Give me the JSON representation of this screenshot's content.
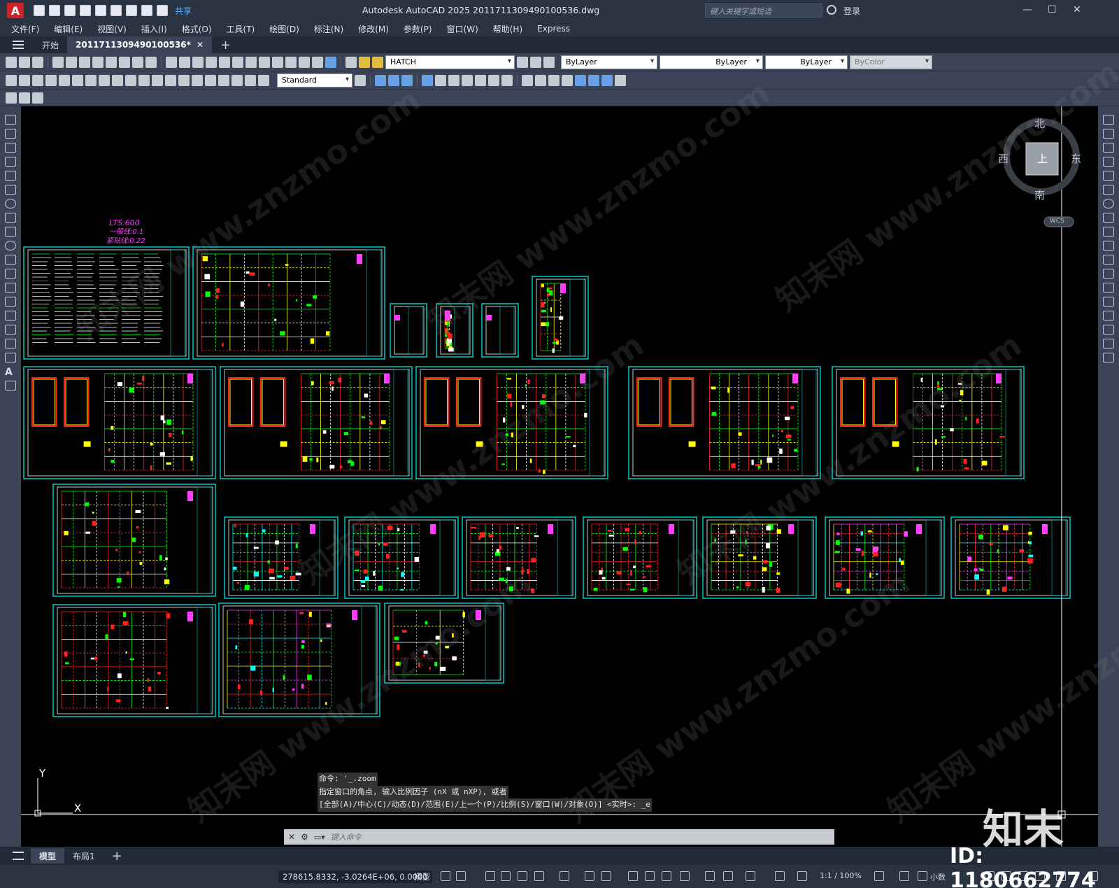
{
  "titlebar": {
    "title": "Autodesk AutoCAD 2025    20117113094901005​36.dwg",
    "search_placeholder": "键入关键字或短语",
    "login": "登录",
    "share": "共享"
  },
  "menu": [
    "文件(F)",
    "编辑(E)",
    "视图(V)",
    "插入(I)",
    "格式(O)",
    "工具(T)",
    "绘图(D)",
    "标注(N)",
    "修改(M)",
    "参数(P)",
    "窗口(W)",
    "帮助(H)",
    "Express"
  ],
  "tabs": {
    "start": "开始",
    "active": "20117113094901005​36*"
  },
  "toolbar": {
    "layer": "HATCH",
    "color": "ByLayer",
    "linetype": "ByLayer",
    "lineweight": "ByLayer",
    "plotstyle": "ByColor",
    "textstyle": "Standard"
  },
  "viewcube": {
    "north": "北",
    "south": "南",
    "east": "东",
    "west": "西",
    "top": "上",
    "wcs": "WCS"
  },
  "drawing_notes": {
    "lts": "LTS:600",
    "line1": "一般线:0.1",
    "line2": "紧贴线:0.22"
  },
  "ucs": {
    "x": "X",
    "y": "Y"
  },
  "command": {
    "history": [
      "命令: '_.zoom",
      "指定窗口的角点, 输入比例因子 (nX 或 nXP), 或者",
      "[全部(A)/中心(C)/动态(D)/范围(E)/上一个(P)/比例(S)/窗口(W)/对象(O)] <实时>: _e"
    ],
    "placeholder": "键入命令"
  },
  "layout_tabs": [
    "模型",
    "布局1"
  ],
  "status": {
    "coords": "278615.8332, -3.0264E+06, 0.0000",
    "model": "模型",
    "scale": "1:1 / 100%",
    "units": "小数"
  },
  "watermark": {
    "logo": "知末",
    "id": "ID: 1180662774",
    "site": "知末网 www.znzmo.com"
  }
}
